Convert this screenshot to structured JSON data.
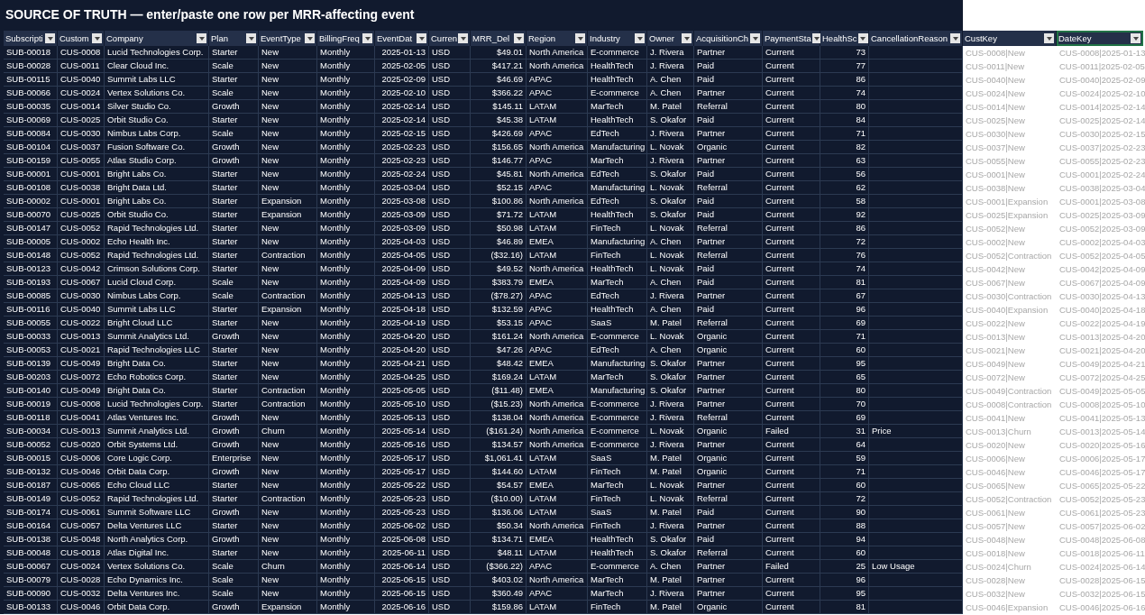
{
  "title": "SOURCE OF TRUTH — enter/paste one row per MRR-affecting event",
  "columns": [
    {
      "label": "Subscripti",
      "selected": false
    },
    {
      "label": "Custom",
      "selected": false
    },
    {
      "label": "Company",
      "selected": false
    },
    {
      "label": "Plan",
      "selected": false
    },
    {
      "label": "EventType",
      "selected": false
    },
    {
      "label": "BillingFreq",
      "selected": false
    },
    {
      "label": "EventDat",
      "selected": false
    },
    {
      "label": "Curren",
      "selected": false
    },
    {
      "label": "MRR_Del",
      "selected": false
    },
    {
      "label": "Region",
      "selected": false
    },
    {
      "label": "Industry",
      "selected": false
    },
    {
      "label": "Owner",
      "selected": false
    },
    {
      "label": "AcquisitionCh",
      "selected": false
    },
    {
      "label": "PaymentSta",
      "selected": false
    },
    {
      "label": "HealthSc",
      "selected": false
    },
    {
      "label": "CancellationReason",
      "selected": false
    },
    {
      "label": "CustKey",
      "selected": false
    },
    {
      "label": "DateKey",
      "selected": true
    }
  ],
  "rows": [
    [
      "SUB-00018",
      "CUS-0008",
      "Lucid Technologies Corp.",
      "Starter",
      "New",
      "Monthly",
      "2025-01-13",
      "USD",
      "$49.01",
      "North America",
      "E-commerce",
      "J. Rivera",
      "Partner",
      "Current",
      "73",
      "",
      "CUS-0008|New",
      "CUS-0008|2025-01-13"
    ],
    [
      "SUB-00028",
      "CUS-0011",
      "Clear Cloud Inc.",
      "Scale",
      "New",
      "Monthly",
      "2025-02-05",
      "USD",
      "$417.21",
      "North America",
      "HealthTech",
      "J. Rivera",
      "Paid",
      "Current",
      "77",
      "",
      "CUS-0011|New",
      "CUS-0011|2025-02-05"
    ],
    [
      "SUB-00115",
      "CUS-0040",
      "Summit Labs LLC",
      "Starter",
      "New",
      "Monthly",
      "2025-02-09",
      "USD",
      "$46.69",
      "APAC",
      "HealthTech",
      "A. Chen",
      "Paid",
      "Current",
      "86",
      "",
      "CUS-0040|New",
      "CUS-0040|2025-02-09"
    ],
    [
      "SUB-00066",
      "CUS-0024",
      "Vertex Solutions Co.",
      "Scale",
      "New",
      "Monthly",
      "2025-02-10",
      "USD",
      "$366.22",
      "APAC",
      "E-commerce",
      "A. Chen",
      "Partner",
      "Current",
      "74",
      "",
      "CUS-0024|New",
      "CUS-0024|2025-02-10"
    ],
    [
      "SUB-00035",
      "CUS-0014",
      "Silver Studio Co.",
      "Growth",
      "New",
      "Monthly",
      "2025-02-14",
      "USD",
      "$145.11",
      "LATAM",
      "MarTech",
      "M. Patel",
      "Referral",
      "Current",
      "80",
      "",
      "CUS-0014|New",
      "CUS-0014|2025-02-14"
    ],
    [
      "SUB-00069",
      "CUS-0025",
      "Orbit Studio Co.",
      "Starter",
      "New",
      "Monthly",
      "2025-02-14",
      "USD",
      "$45.38",
      "LATAM",
      "HealthTech",
      "S. Okafor",
      "Paid",
      "Current",
      "84",
      "",
      "CUS-0025|New",
      "CUS-0025|2025-02-14"
    ],
    [
      "SUB-00084",
      "CUS-0030",
      "Nimbus Labs Corp.",
      "Scale",
      "New",
      "Monthly",
      "2025-02-15",
      "USD",
      "$426.69",
      "APAC",
      "EdTech",
      "J. Rivera",
      "Partner",
      "Current",
      "71",
      "",
      "CUS-0030|New",
      "CUS-0030|2025-02-15"
    ],
    [
      "SUB-00104",
      "CUS-0037",
      "Fusion Software Co.",
      "Growth",
      "New",
      "Monthly",
      "2025-02-23",
      "USD",
      "$156.65",
      "North America",
      "Manufacturing",
      "L. Novak",
      "Organic",
      "Current",
      "82",
      "",
      "CUS-0037|New",
      "CUS-0037|2025-02-23"
    ],
    [
      "SUB-00159",
      "CUS-0055",
      "Atlas Studio Corp.",
      "Growth",
      "New",
      "Monthly",
      "2025-02-23",
      "USD",
      "$146.77",
      "APAC",
      "MarTech",
      "J. Rivera",
      "Partner",
      "Current",
      "63",
      "",
      "CUS-0055|New",
      "CUS-0055|2025-02-23"
    ],
    [
      "SUB-00001",
      "CUS-0001",
      "Bright Labs Co.",
      "Starter",
      "New",
      "Monthly",
      "2025-02-24",
      "USD",
      "$45.81",
      "North America",
      "EdTech",
      "S. Okafor",
      "Paid",
      "Current",
      "56",
      "",
      "CUS-0001|New",
      "CUS-0001|2025-02-24"
    ],
    [
      "SUB-00108",
      "CUS-0038",
      "Bright Data Ltd.",
      "Starter",
      "New",
      "Monthly",
      "2025-03-04",
      "USD",
      "$52.15",
      "APAC",
      "Manufacturing",
      "L. Novak",
      "Referral",
      "Current",
      "62",
      "",
      "CUS-0038|New",
      "CUS-0038|2025-03-04"
    ],
    [
      "SUB-00002",
      "CUS-0001",
      "Bright Labs Co.",
      "Starter",
      "Expansion",
      "Monthly",
      "2025-03-08",
      "USD",
      "$100.86",
      "North America",
      "EdTech",
      "S. Okafor",
      "Paid",
      "Current",
      "58",
      "",
      "CUS-0001|Expansion",
      "CUS-0001|2025-03-08"
    ],
    [
      "SUB-00070",
      "CUS-0025",
      "Orbit Studio Co.",
      "Starter",
      "Expansion",
      "Monthly",
      "2025-03-09",
      "USD",
      "$71.72",
      "LATAM",
      "HealthTech",
      "S. Okafor",
      "Paid",
      "Current",
      "92",
      "",
      "CUS-0025|Expansion",
      "CUS-0025|2025-03-09"
    ],
    [
      "SUB-00147",
      "CUS-0052",
      "Rapid Technologies Ltd.",
      "Starter",
      "New",
      "Monthly",
      "2025-03-09",
      "USD",
      "$50.98",
      "LATAM",
      "FinTech",
      "L. Novak",
      "Referral",
      "Current",
      "86",
      "",
      "CUS-0052|New",
      "CUS-0052|2025-03-09"
    ],
    [
      "SUB-00005",
      "CUS-0002",
      "Echo Health Inc.",
      "Starter",
      "New",
      "Monthly",
      "2025-04-03",
      "USD",
      "$46.89",
      "EMEA",
      "Manufacturing",
      "A. Chen",
      "Partner",
      "Current",
      "72",
      "",
      "CUS-0002|New",
      "CUS-0002|2025-04-03"
    ],
    [
      "SUB-00148",
      "CUS-0052",
      "Rapid Technologies Ltd.",
      "Starter",
      "Contraction",
      "Monthly",
      "2025-04-05",
      "USD",
      "($32.16)",
      "LATAM",
      "FinTech",
      "L. Novak",
      "Referral",
      "Current",
      "76",
      "",
      "CUS-0052|Contraction",
      "CUS-0052|2025-04-05"
    ],
    [
      "SUB-00123",
      "CUS-0042",
      "Crimson Solutions Corp.",
      "Starter",
      "New",
      "Monthly",
      "2025-04-09",
      "USD",
      "$49.52",
      "North America",
      "HealthTech",
      "L. Novak",
      "Paid",
      "Current",
      "74",
      "",
      "CUS-0042|New",
      "CUS-0042|2025-04-09"
    ],
    [
      "SUB-00193",
      "CUS-0067",
      "Lucid Cloud Corp.",
      "Scale",
      "New",
      "Monthly",
      "2025-04-09",
      "USD",
      "$383.79",
      "EMEA",
      "MarTech",
      "A. Chen",
      "Paid",
      "Current",
      "81",
      "",
      "CUS-0067|New",
      "CUS-0067|2025-04-09"
    ],
    [
      "SUB-00085",
      "CUS-0030",
      "Nimbus Labs Corp.",
      "Scale",
      "Contraction",
      "Monthly",
      "2025-04-13",
      "USD",
      "($78.27)",
      "APAC",
      "EdTech",
      "J. Rivera",
      "Partner",
      "Current",
      "67",
      "",
      "CUS-0030|Contraction",
      "CUS-0030|2025-04-13"
    ],
    [
      "SUB-00116",
      "CUS-0040",
      "Summit Labs LLC",
      "Starter",
      "Expansion",
      "Monthly",
      "2025-04-18",
      "USD",
      "$132.59",
      "APAC",
      "HealthTech",
      "A. Chen",
      "Paid",
      "Current",
      "96",
      "",
      "CUS-0040|Expansion",
      "CUS-0040|2025-04-18"
    ],
    [
      "SUB-00055",
      "CUS-0022",
      "Bright Cloud LLC",
      "Starter",
      "New",
      "Monthly",
      "2025-04-19",
      "USD",
      "$53.15",
      "APAC",
      "SaaS",
      "M. Patel",
      "Referral",
      "Current",
      "69",
      "",
      "CUS-0022|New",
      "CUS-0022|2025-04-19"
    ],
    [
      "SUB-00033",
      "CUS-0013",
      "Summit Analytics Ltd.",
      "Growth",
      "New",
      "Monthly",
      "2025-04-20",
      "USD",
      "$161.24",
      "North America",
      "E-commerce",
      "L. Novak",
      "Organic",
      "Current",
      "71",
      "",
      "CUS-0013|New",
      "CUS-0013|2025-04-20"
    ],
    [
      "SUB-00053",
      "CUS-0021",
      "Rapid Technologies LLC",
      "Starter",
      "New",
      "Monthly",
      "2025-04-20",
      "USD",
      "$47.26",
      "APAC",
      "EdTech",
      "A. Chen",
      "Organic",
      "Current",
      "60",
      "",
      "CUS-0021|New",
      "CUS-0021|2025-04-20"
    ],
    [
      "SUB-00139",
      "CUS-0049",
      "Bright Data Co.",
      "Starter",
      "New",
      "Monthly",
      "2025-04-21",
      "USD",
      "$48.42",
      "EMEA",
      "Manufacturing",
      "S. Okafor",
      "Partner",
      "Current",
      "95",
      "",
      "CUS-0049|New",
      "CUS-0049|2025-04-21"
    ],
    [
      "SUB-00203",
      "CUS-0072",
      "Echo Robotics Corp.",
      "Starter",
      "New",
      "Monthly",
      "2025-04-25",
      "USD",
      "$169.24",
      "LATAM",
      "MarTech",
      "S. Okafor",
      "Partner",
      "Current",
      "65",
      "",
      "CUS-0072|New",
      "CUS-0072|2025-04-25"
    ],
    [
      "SUB-00140",
      "CUS-0049",
      "Bright Data Co.",
      "Starter",
      "Contraction",
      "Monthly",
      "2025-05-05",
      "USD",
      "($11.48)",
      "EMEA",
      "Manufacturing",
      "S. Okafor",
      "Partner",
      "Current",
      "80",
      "",
      "CUS-0049|Contraction",
      "CUS-0049|2025-05-05"
    ],
    [
      "SUB-00019",
      "CUS-0008",
      "Lucid Technologies Corp.",
      "Starter",
      "Contraction",
      "Monthly",
      "2025-05-10",
      "USD",
      "($15.23)",
      "North America",
      "E-commerce",
      "J. Rivera",
      "Partner",
      "Current",
      "70",
      "",
      "CUS-0008|Contraction",
      "CUS-0008|2025-05-10"
    ],
    [
      "SUB-00118",
      "CUS-0041",
      "Atlas Ventures Inc.",
      "Growth",
      "New",
      "Monthly",
      "2025-05-13",
      "USD",
      "$138.04",
      "North America",
      "E-commerce",
      "J. Rivera",
      "Referral",
      "Current",
      "69",
      "",
      "CUS-0041|New",
      "CUS-0041|2025-05-13"
    ],
    [
      "SUB-00034",
      "CUS-0013",
      "Summit Analytics Ltd.",
      "Growth",
      "Churn",
      "Monthly",
      "2025-05-14",
      "USD",
      "($161.24)",
      "North America",
      "E-commerce",
      "L. Novak",
      "Organic",
      "Failed",
      "31",
      "Price",
      "CUS-0013|Churn",
      "CUS-0013|2025-05-14"
    ],
    [
      "SUB-00052",
      "CUS-0020",
      "Orbit Systems Ltd.",
      "Growth",
      "New",
      "Monthly",
      "2025-05-16",
      "USD",
      "$134.57",
      "North America",
      "E-commerce",
      "J. Rivera",
      "Partner",
      "Current",
      "64",
      "",
      "CUS-0020|New",
      "CUS-0020|2025-05-16"
    ],
    [
      "SUB-00015",
      "CUS-0006",
      "Core Logic Corp.",
      "Enterprise",
      "New",
      "Monthly",
      "2025-05-17",
      "USD",
      "$1,061.41",
      "LATAM",
      "SaaS",
      "M. Patel",
      "Organic",
      "Current",
      "59",
      "",
      "CUS-0006|New",
      "CUS-0006|2025-05-17"
    ],
    [
      "SUB-00132",
      "CUS-0046",
      "Orbit Data Corp.",
      "Growth",
      "New",
      "Monthly",
      "2025-05-17",
      "USD",
      "$144.60",
      "LATAM",
      "FinTech",
      "M. Patel",
      "Organic",
      "Current",
      "71",
      "",
      "CUS-0046|New",
      "CUS-0046|2025-05-17"
    ],
    [
      "SUB-00187",
      "CUS-0065",
      "Echo Cloud LLC",
      "Starter",
      "New",
      "Monthly",
      "2025-05-22",
      "USD",
      "$54.57",
      "EMEA",
      "MarTech",
      "L. Novak",
      "Partner",
      "Current",
      "60",
      "",
      "CUS-0065|New",
      "CUS-0065|2025-05-22"
    ],
    [
      "SUB-00149",
      "CUS-0052",
      "Rapid Technologies Ltd.",
      "Starter",
      "Contraction",
      "Monthly",
      "2025-05-23",
      "USD",
      "($10.00)",
      "LATAM",
      "FinTech",
      "L. Novak",
      "Referral",
      "Current",
      "72",
      "",
      "CUS-0052|Contraction",
      "CUS-0052|2025-05-23"
    ],
    [
      "SUB-00174",
      "CUS-0061",
      "Summit Software LLC",
      "Growth",
      "New",
      "Monthly",
      "2025-05-23",
      "USD",
      "$136.06",
      "LATAM",
      "SaaS",
      "M. Patel",
      "Paid",
      "Current",
      "90",
      "",
      "CUS-0061|New",
      "CUS-0061|2025-05-23"
    ],
    [
      "SUB-00164",
      "CUS-0057",
      "Delta Ventures LLC",
      "Starter",
      "New",
      "Monthly",
      "2025-06-02",
      "USD",
      "$50.34",
      "North America",
      "FinTech",
      "J. Rivera",
      "Partner",
      "Current",
      "88",
      "",
      "CUS-0057|New",
      "CUS-0057|2025-06-02"
    ],
    [
      "SUB-00138",
      "CUS-0048",
      "North Analytics Corp.",
      "Growth",
      "New",
      "Monthly",
      "2025-06-08",
      "USD",
      "$134.71",
      "EMEA",
      "HealthTech",
      "S. Okafor",
      "Paid",
      "Current",
      "94",
      "",
      "CUS-0048|New",
      "CUS-0048|2025-06-08"
    ],
    [
      "SUB-00048",
      "CUS-0018",
      "Atlas Digital Inc.",
      "Starter",
      "New",
      "Monthly",
      "2025-06-11",
      "USD",
      "$48.11",
      "LATAM",
      "HealthTech",
      "S. Okafor",
      "Referral",
      "Current",
      "60",
      "",
      "CUS-0018|New",
      "CUS-0018|2025-06-11"
    ],
    [
      "SUB-00067",
      "CUS-0024",
      "Vertex Solutions Co.",
      "Scale",
      "Churn",
      "Monthly",
      "2025-06-14",
      "USD",
      "($366.22)",
      "APAC",
      "E-commerce",
      "A. Chen",
      "Partner",
      "Failed",
      "25",
      "Low Usage",
      "CUS-0024|Churn",
      "CUS-0024|2025-06-14"
    ],
    [
      "SUB-00079",
      "CUS-0028",
      "Echo Dynamics Inc.",
      "Scale",
      "New",
      "Monthly",
      "2025-06-15",
      "USD",
      "$403.02",
      "North America",
      "MarTech",
      "M. Patel",
      "Partner",
      "Current",
      "96",
      "",
      "CUS-0028|New",
      "CUS-0028|2025-06-15"
    ],
    [
      "SUB-00090",
      "CUS-0032",
      "Delta Ventures Inc.",
      "Scale",
      "New",
      "Monthly",
      "2025-06-15",
      "USD",
      "$360.49",
      "APAC",
      "MarTech",
      "J. Rivera",
      "Partner",
      "Current",
      "95",
      "",
      "CUS-0032|New",
      "CUS-0032|2025-06-15"
    ],
    [
      "SUB-00133",
      "CUS-0046",
      "Orbit Data Corp.",
      "Growth",
      "Expansion",
      "Monthly",
      "2025-06-16",
      "USD",
      "$159.86",
      "LATAM",
      "FinTech",
      "M. Patel",
      "Organic",
      "Current",
      "81",
      "",
      "CUS-0046|Expansion",
      "CUS-0046|2025-06-16"
    ]
  ]
}
